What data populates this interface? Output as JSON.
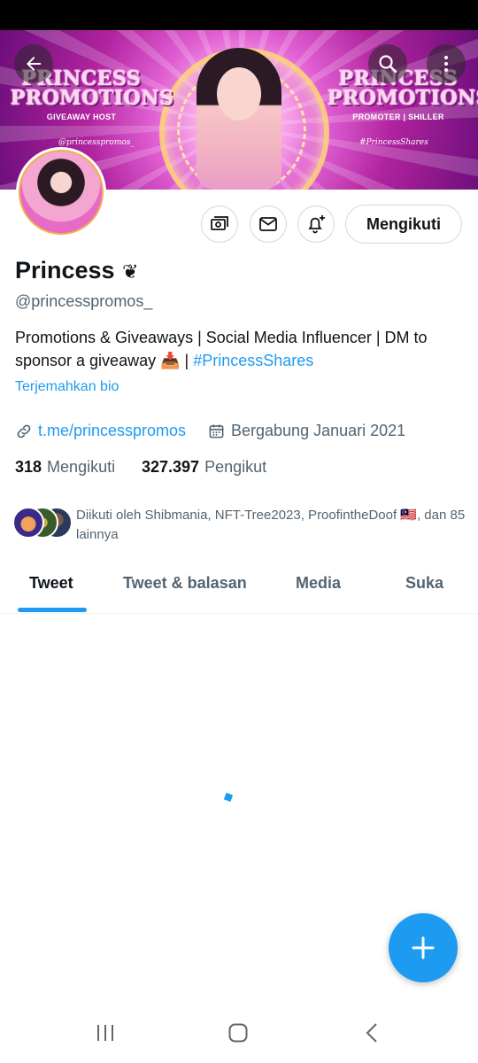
{
  "banner": {
    "left_brand_line1": "PRINCESS",
    "left_brand_line2": "PROMOTIONS",
    "left_sub": "GIVEAWAY HOST",
    "right_brand_line1": "PRINCESS",
    "right_brand_line2": "PROMOTIONS",
    "right_sub": "PROMOTER | SHILLER",
    "left_tag": "@princesspromos_",
    "right_tag": "#PrincessShares"
  },
  "header": {
    "back_icon": "arrow-left-icon",
    "search_icon": "search-icon",
    "more_icon": "more-vertical-icon"
  },
  "actions": {
    "tip_icon": "money-icon",
    "message_icon": "mail-icon",
    "notify_icon": "bell-plus-icon",
    "follow_label": "Mengikuti"
  },
  "profile": {
    "name": "Princess",
    "name_emoji": "❦",
    "handle": "@princesspromos_",
    "bio_text": "Promotions & Giveaways | Social Media Influencer | DM to sponsor a giveaway 📥 | ",
    "bio_hashtag": "#PrincessShares",
    "translate_label": "Terjemahkan bio",
    "link": "t.me/princesspromos",
    "joined": "Bergabung Januari 2021",
    "following_count": "318",
    "following_label": "Mengikuti",
    "followers_count": "327.397",
    "followers_label": "Pengikut",
    "followed_by": "Diikuti oleh Shibmania, NFT-Tree2023, ProofintheDoof 🇲🇾, dan 85 lainnya"
  },
  "tabs": [
    {
      "label": "Tweet"
    },
    {
      "label": "Tweet & balasan"
    },
    {
      "label": "Media"
    },
    {
      "label": "Suka"
    }
  ],
  "colors": {
    "accent": "#1d9bf0",
    "secondary_text": "#536471",
    "primary_text": "#0f1419"
  }
}
